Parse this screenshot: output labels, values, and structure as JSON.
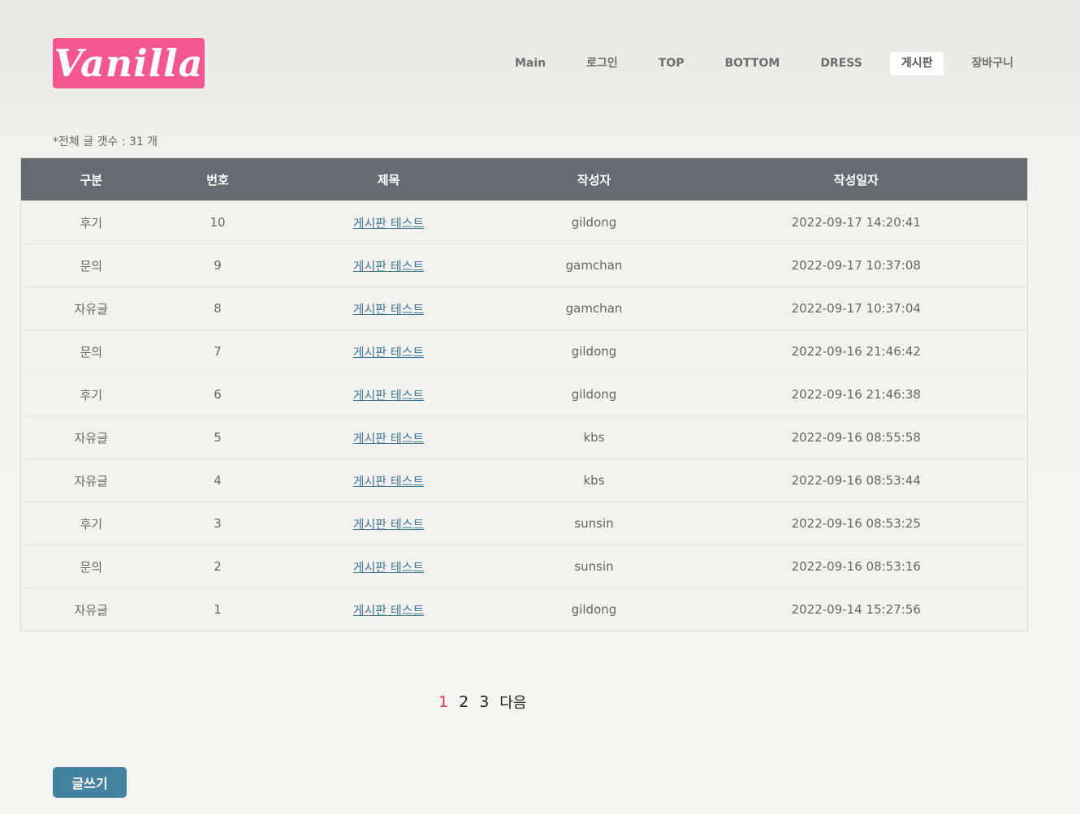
{
  "logo": {
    "text": "Vanilla"
  },
  "nav": {
    "items": [
      "Main",
      "로그인",
      "TOP",
      "BOTTOM",
      "DRESS",
      "게시판",
      "장바구니"
    ],
    "active": "게시판"
  },
  "board": {
    "count_text": "*전체 글 갯수 : 31 개",
    "headers": [
      "구분",
      "번호",
      "제목",
      "작성자",
      "작성일자"
    ],
    "rows": [
      [
        "후기",
        "10",
        "게시판 테스트",
        "gildong",
        "2022-09-17 14:20:41"
      ],
      [
        "문의",
        "9",
        "게시판 테스트",
        "gamchan",
        "2022-09-17 10:37:08"
      ],
      [
        "자유글",
        "8",
        "게시판 테스트",
        "gamchan",
        "2022-09-17 10:37:04"
      ],
      [
        "문의",
        "7",
        "게시판 테스트",
        "gildong",
        "2022-09-16 21:46:42"
      ],
      [
        "후기",
        "6",
        "게시판 테스트",
        "gildong",
        "2022-09-16 21:46:38"
      ],
      [
        "자유글",
        "5",
        "게시판 테스트",
        "kbs",
        "2022-09-16 08:55:58"
      ],
      [
        "자유글",
        "4",
        "게시판 테스트",
        "kbs",
        "2022-09-16 08:53:44"
      ],
      [
        "후기",
        "3",
        "게시판 테스트",
        "sunsin",
        "2022-09-16 08:53:25"
      ],
      [
        "문의",
        "2",
        "게시판 테스트",
        "sunsin",
        "2022-09-16 08:53:16"
      ],
      [
        "자유글",
        "1",
        "게시판 테스트",
        "gildong",
        "2022-09-14 15:27:56"
      ]
    ]
  },
  "pagination": {
    "pages": [
      "1",
      "2",
      "3"
    ],
    "current": "1",
    "next_label": "다음"
  },
  "write_button": {
    "label": "글쓰기"
  },
  "colors": {
    "logo_bg": "#f2578f",
    "header_bg": "#646c72",
    "link": "#3f7893",
    "current_page": "#d9383f",
    "button_bg": "#44839f"
  }
}
